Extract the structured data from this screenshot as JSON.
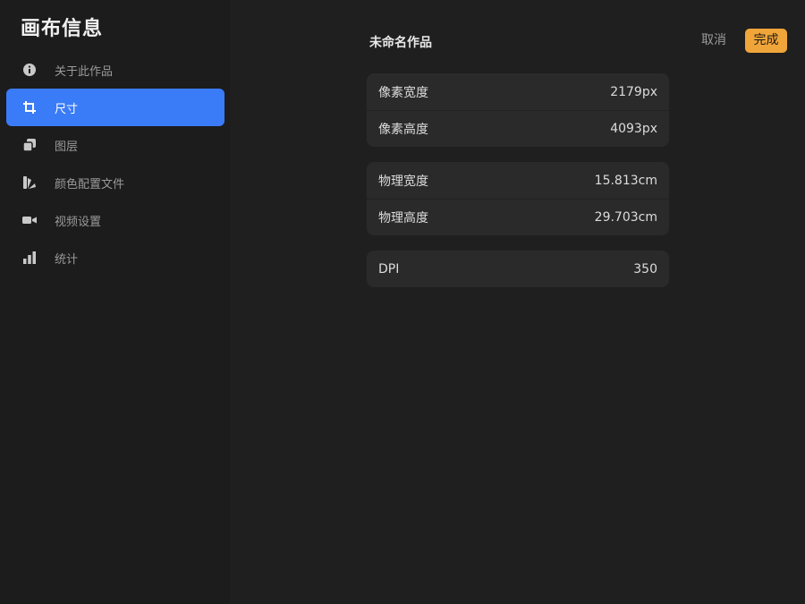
{
  "sidebar": {
    "title": "画布信息",
    "items": [
      {
        "label": "关于此作品",
        "icon": "info-icon",
        "active": false
      },
      {
        "label": "尺寸",
        "icon": "crop-icon",
        "active": true
      },
      {
        "label": "图层",
        "icon": "layers-icon",
        "active": false
      },
      {
        "label": "颜色配置文件",
        "icon": "color-profile-icon",
        "active": false
      },
      {
        "label": "视频设置",
        "icon": "video-camera-icon",
        "active": false
      },
      {
        "label": "统计",
        "icon": "bar-chart-icon",
        "active": false
      }
    ]
  },
  "header": {
    "title": "未命名作品",
    "cancel_label": "取消",
    "done_label": "完成"
  },
  "colors": {
    "accent": "#3a7bf7",
    "done_button": "#f0a53a",
    "background": "#1f1f1f",
    "card": "#2a2a2a"
  },
  "dimensions": {
    "pixel_group": [
      {
        "label": "像素宽度",
        "value": "2179px"
      },
      {
        "label": "像素高度",
        "value": "4093px"
      }
    ],
    "physical_group": [
      {
        "label": "物理宽度",
        "value": "15.813cm"
      },
      {
        "label": "物理高度",
        "value": "29.703cm"
      }
    ],
    "dpi_group": [
      {
        "label": "DPI",
        "value": "350"
      }
    ]
  }
}
